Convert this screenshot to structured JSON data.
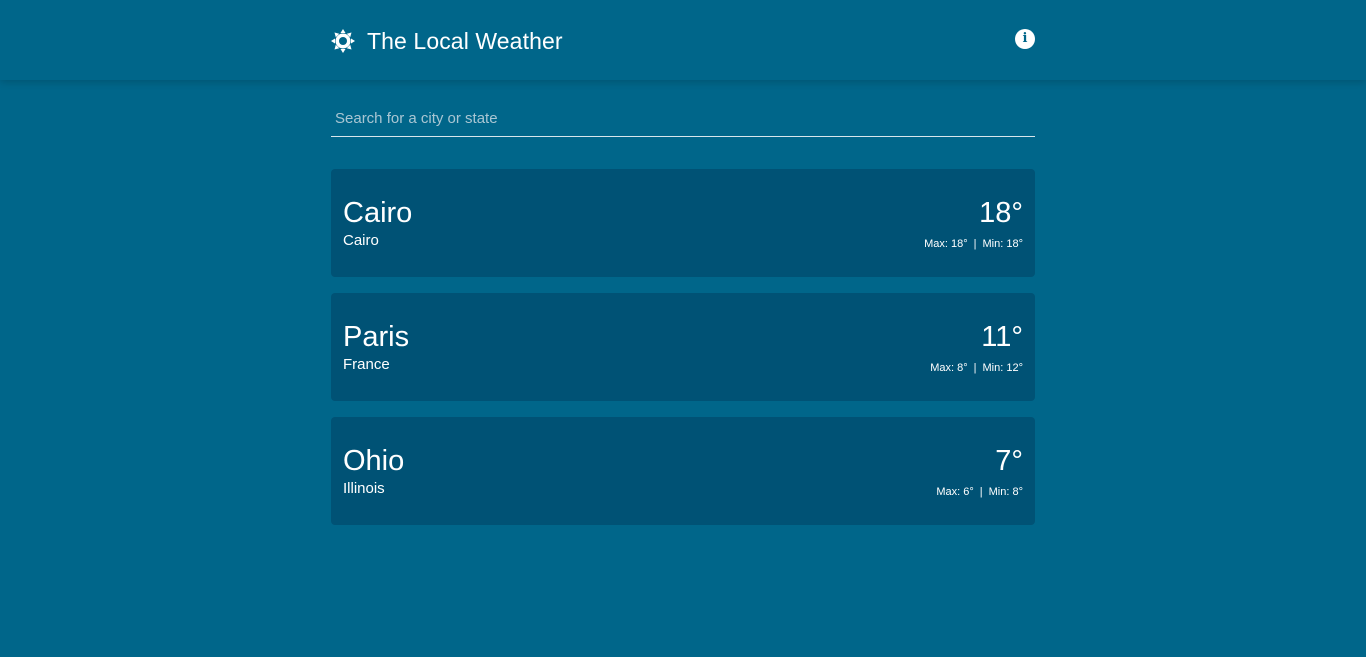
{
  "app": {
    "title": "The Local Weather",
    "sun_icon": "sun-gear-icon",
    "info_icon": "info-icon"
  },
  "search": {
    "placeholder": "Search for a city or state",
    "value": ""
  },
  "cards": [
    {
      "city": "Cairo",
      "region": "Cairo",
      "temp": "18°",
      "max": "Max: 18°",
      "min": "Min: 18°"
    },
    {
      "city": "Paris",
      "region": "France",
      "temp": "11°",
      "max": "Max: 8°",
      "min": "Min: 12°"
    },
    {
      "city": "Ohio",
      "region": "Illinois",
      "temp": "7°",
      "max": "Max: 6°",
      "min": "Min: 8°"
    }
  ],
  "colors": {
    "background": "#00668a",
    "card": "#005275",
    "text": "#ffffff"
  }
}
